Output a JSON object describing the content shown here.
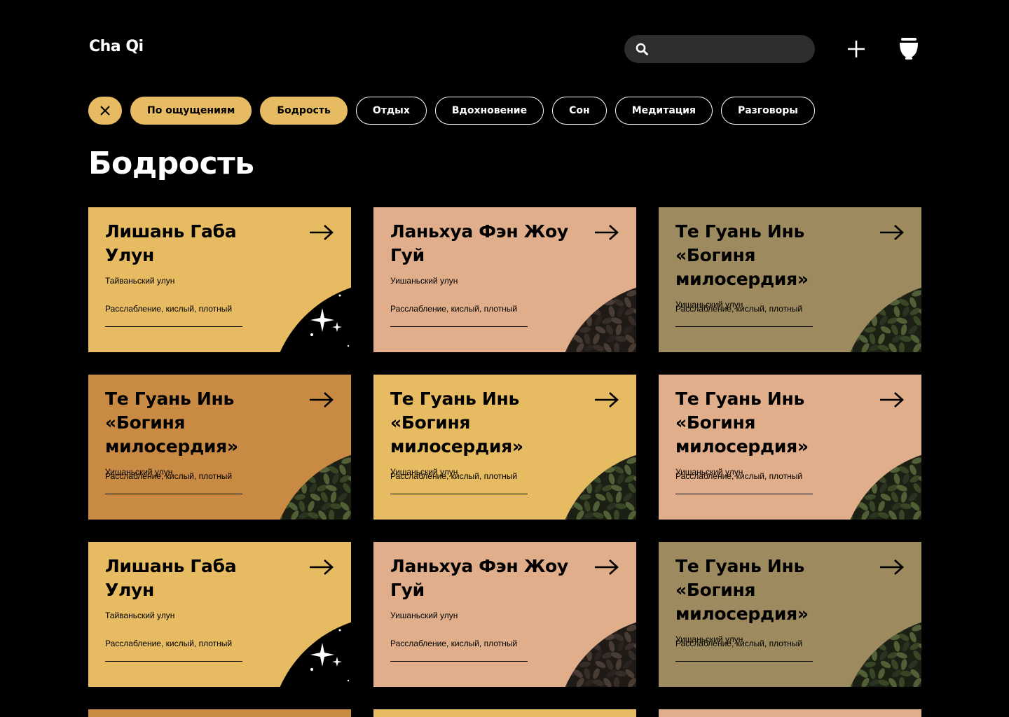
{
  "header": {
    "logo": "Cha Qi",
    "search_placeholder": "",
    "add_icon": "plus-icon",
    "cup_icon": "tea-cup-icon"
  },
  "filters": {
    "clear_icon": "close-icon",
    "items": [
      {
        "label": "По ощущениям",
        "active": true
      },
      {
        "label": "Бодрость",
        "active": true
      },
      {
        "label": "Отдых",
        "active": false
      },
      {
        "label": "Вдохновение",
        "active": false
      },
      {
        "label": "Сон",
        "active": false
      },
      {
        "label": "Медитация",
        "active": false
      },
      {
        "label": "Разговоры",
        "active": false
      }
    ]
  },
  "page_title": "Бодрость",
  "colors": {
    "yellow": "#e7bb61",
    "peach": "#e0ae8a",
    "olive": "#9d8a5f",
    "ochre": "#c98a43"
  },
  "cards": [
    {
      "title": "Лишань Габа Улун",
      "region": "Тайваньский улун",
      "notes": "Расслабление, кислый, плотный",
      "color": "yellow",
      "image": "stars"
    },
    {
      "title": "Ланьхуа Фэн Жоу Гуй",
      "region": "Уишаньский улун",
      "notes": "Расслабление, кислый, плотный",
      "color": "peach",
      "image": "dark-leaves"
    },
    {
      "title": "Те Гуань Инь «Богиня милосердия»",
      "region": "Уишаньский улун",
      "notes": "Расслабление, кислый, плотный",
      "color": "olive",
      "image": "green-leaves"
    },
    {
      "title": "Те Гуань Инь «Богиня милосердия»",
      "region": "Уишаньский улун",
      "notes": "Расслабление, кислый, плотный",
      "color": "ochre",
      "image": "green-leaves"
    },
    {
      "title": "Те Гуань Инь «Богиня милосердия»",
      "region": "Уишаньский улун",
      "notes": "Расслабление, кислый, плотный",
      "color": "yellow",
      "image": "green-leaves"
    },
    {
      "title": "Те Гуань Инь «Богиня милосердия»",
      "region": "Уишаньский улун",
      "notes": "Расслабление, кислый, плотный",
      "color": "peach",
      "image": "green-leaves"
    },
    {
      "title": "Лишань Габа Улун",
      "region": "Тайваньский улун",
      "notes": "Расслабление, кислый, плотный",
      "color": "yellow",
      "image": "stars"
    },
    {
      "title": "Ланьхуа Фэн Жоу Гуй",
      "region": "Уишаньский улун",
      "notes": "Расслабление, кислый, плотный",
      "color": "peach",
      "image": "dark-leaves"
    },
    {
      "title": "Те Гуань Инь «Богиня милосердия»",
      "region": "Уишаньский улун",
      "notes": "Расслабление, кислый, плотный",
      "color": "olive",
      "image": "green-leaves"
    }
  ],
  "next_row_colors": [
    "ochre",
    "yellow",
    "peach"
  ]
}
